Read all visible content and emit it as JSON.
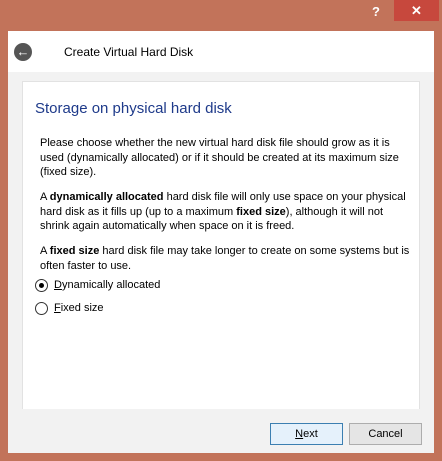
{
  "titlebar": {
    "help_label": "?",
    "close_label": "✕"
  },
  "header": {
    "back_icon": "←",
    "title": "Create Virtual Hard Disk"
  },
  "panel": {
    "title": "Storage on physical hard disk",
    "paragraph1": "Please choose whether the new virtual hard disk file should grow as it is used (dynamically allocated) or if it should be created at its maximum size (fixed size).",
    "paragraph2": {
      "prefix": "A ",
      "bold1": "dynamically allocated",
      "middle": " hard disk file will only use space on your physical hard disk as it fills up (up to a maximum ",
      "bold2": "fixed size",
      "suffix": "), although it will not shrink again automatically when space on it is freed."
    },
    "paragraph3": {
      "prefix": "A ",
      "bold": "fixed size",
      "suffix": " hard disk file may take longer to create on some systems but is often faster to use."
    },
    "options": [
      {
        "first": "D",
        "rest": "ynamically allocated",
        "selected": true
      },
      {
        "first": "F",
        "rest": "ixed size",
        "selected": false
      }
    ]
  },
  "footer": {
    "next_first": "N",
    "next_rest": "ext",
    "cancel_label": "Cancel"
  }
}
